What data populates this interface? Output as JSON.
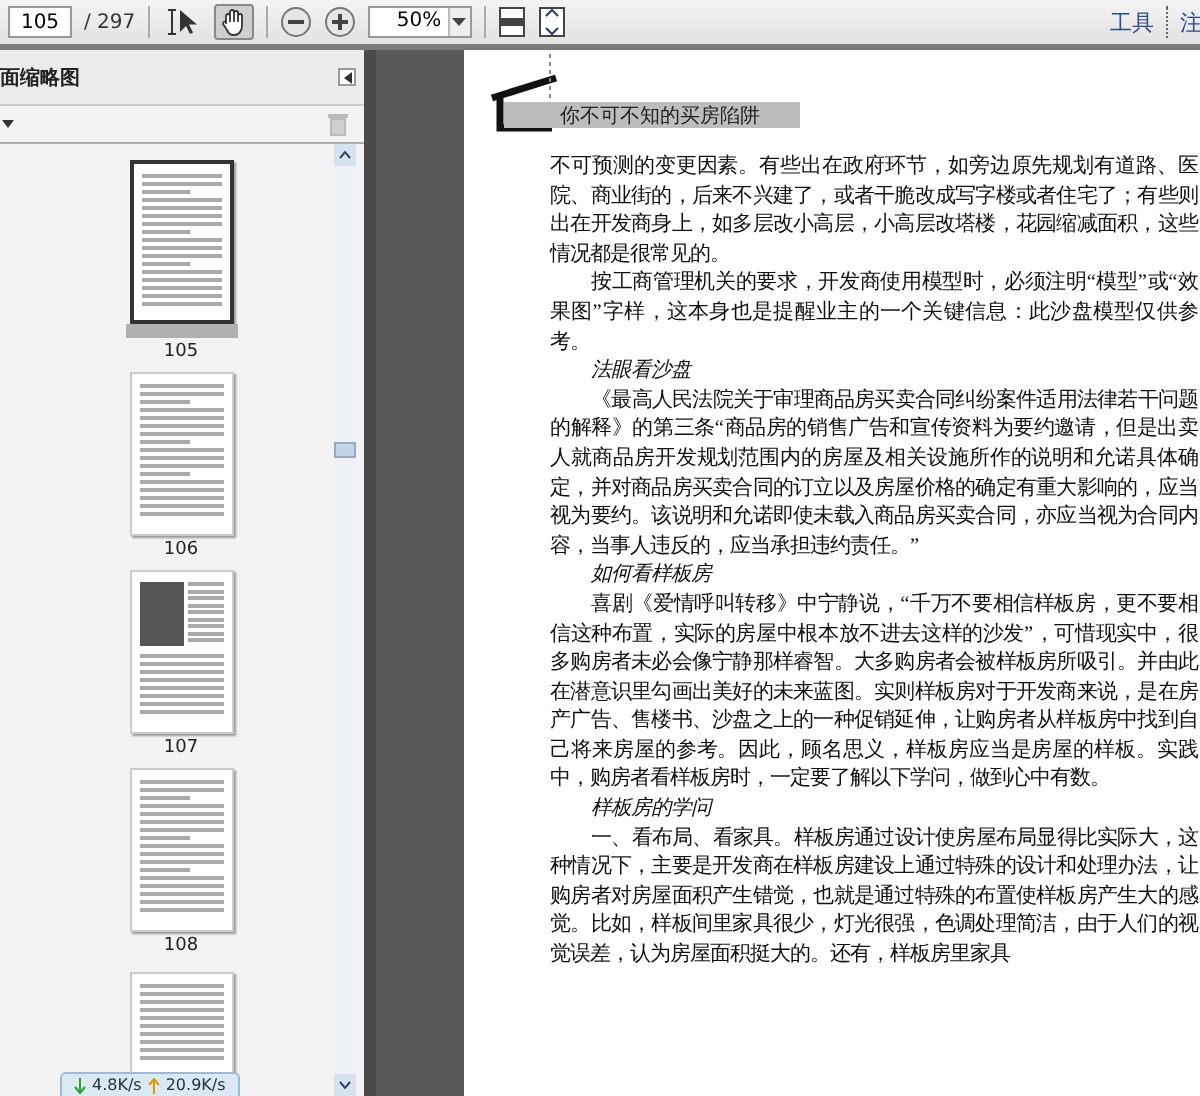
{
  "toolbar": {
    "page_number": "105",
    "page_total": "/ 297",
    "tools": [
      {
        "kind": "select",
        "selected": false
      },
      {
        "kind": "hand",
        "selected": true
      }
    ],
    "zoom": "50%",
    "tools_link": "工具",
    "comment_link": "注"
  },
  "sidebar": {
    "title": "面缩略图",
    "thumbnails": [
      {
        "label": "105",
        "selected": true,
        "kind": "text"
      },
      {
        "label": "106",
        "selected": false,
        "kind": "text"
      },
      {
        "label": "107",
        "selected": false,
        "kind": "photo"
      },
      {
        "label": "108",
        "selected": false,
        "kind": "text"
      }
    ]
  },
  "network": {
    "download": "4.8K/s",
    "upload": "20.9K/s"
  },
  "page": {
    "running_head": "你不可不知的买房陷阱",
    "blocks": [
      {
        "kind": "continued",
        "text": "不可预测的变更因素。有些出在政府环节，如旁边原先规划有道路、医院、商业街的，后来不兴建了，或者干脆改成写字楼或者住宅了；有些则出在开发商身上，如多层改小高层，小高层改塔楼，花园缩减面积，这些情况都是很常见的。"
      },
      {
        "kind": "paragraph",
        "text": "按工商管理机关的要求，开发商使用模型时，必须注明“模型”或“效果图”字样，这本身也是提醒业主的一个关键信息：此沙盘模型仅供参考。"
      },
      {
        "kind": "subheading",
        "text": "法眼看沙盘"
      },
      {
        "kind": "paragraph",
        "text": "《最高人民法院关于审理商品房买卖合同纠纷案件适用法律若干问题的解释》的第三条“商品房的销售广告和宣传资料为要约邀请，但是出卖人就商品房开发规划范围内的房屋及相关设施所作的说明和允诺具体确定，并对商品房买卖合同的订立以及房屋价格的确定有重大影响的，应当视为要约。该说明和允诺即使未载入商品房买卖合同，亦应当视为合同内容，当事人违反的，应当承担违约责任。”"
      },
      {
        "kind": "subheading",
        "text": "如何看样板房"
      },
      {
        "kind": "paragraph",
        "text": "喜剧《爱情呼叫转移》中宁静说，“千万不要相信样板房，更不要相信这种布置，实际的房屋中根本放不进去这样的沙发”，可惜现实中，很多购房者未必会像宁静那样睿智。大多购房者会被样板房所吸引。并由此在潜意识里勾画出美好的未来蓝图。实则样板房对于开发商来说，是在房产广告、售楼书、沙盘之上的一种促销延伸，让购房者从样板房中找到自己将来房屋的参考。因此，顾名思义，样板房应当是房屋的样板。实践中，购房者看样板房时，一定要了解以下学问，做到心中有数。"
      },
      {
        "kind": "subheading",
        "text": "样板房的学问"
      },
      {
        "kind": "paragraph",
        "text": "一、看布局、看家具。样板房通过设计使房屋布局显得比实际大，这种情况下，主要是开发商在样板房建设上通过特殊的设计和处理办法，让购房者对房屋面积产生错觉，也就是通过特殊的布置使样板房产生大的感觉。比如，样板间里家具很少，灯光很强，色调处理简洁，由于人们的视觉误差，认为房屋面积挺大的。还有，样板房里家具"
      }
    ]
  }
}
